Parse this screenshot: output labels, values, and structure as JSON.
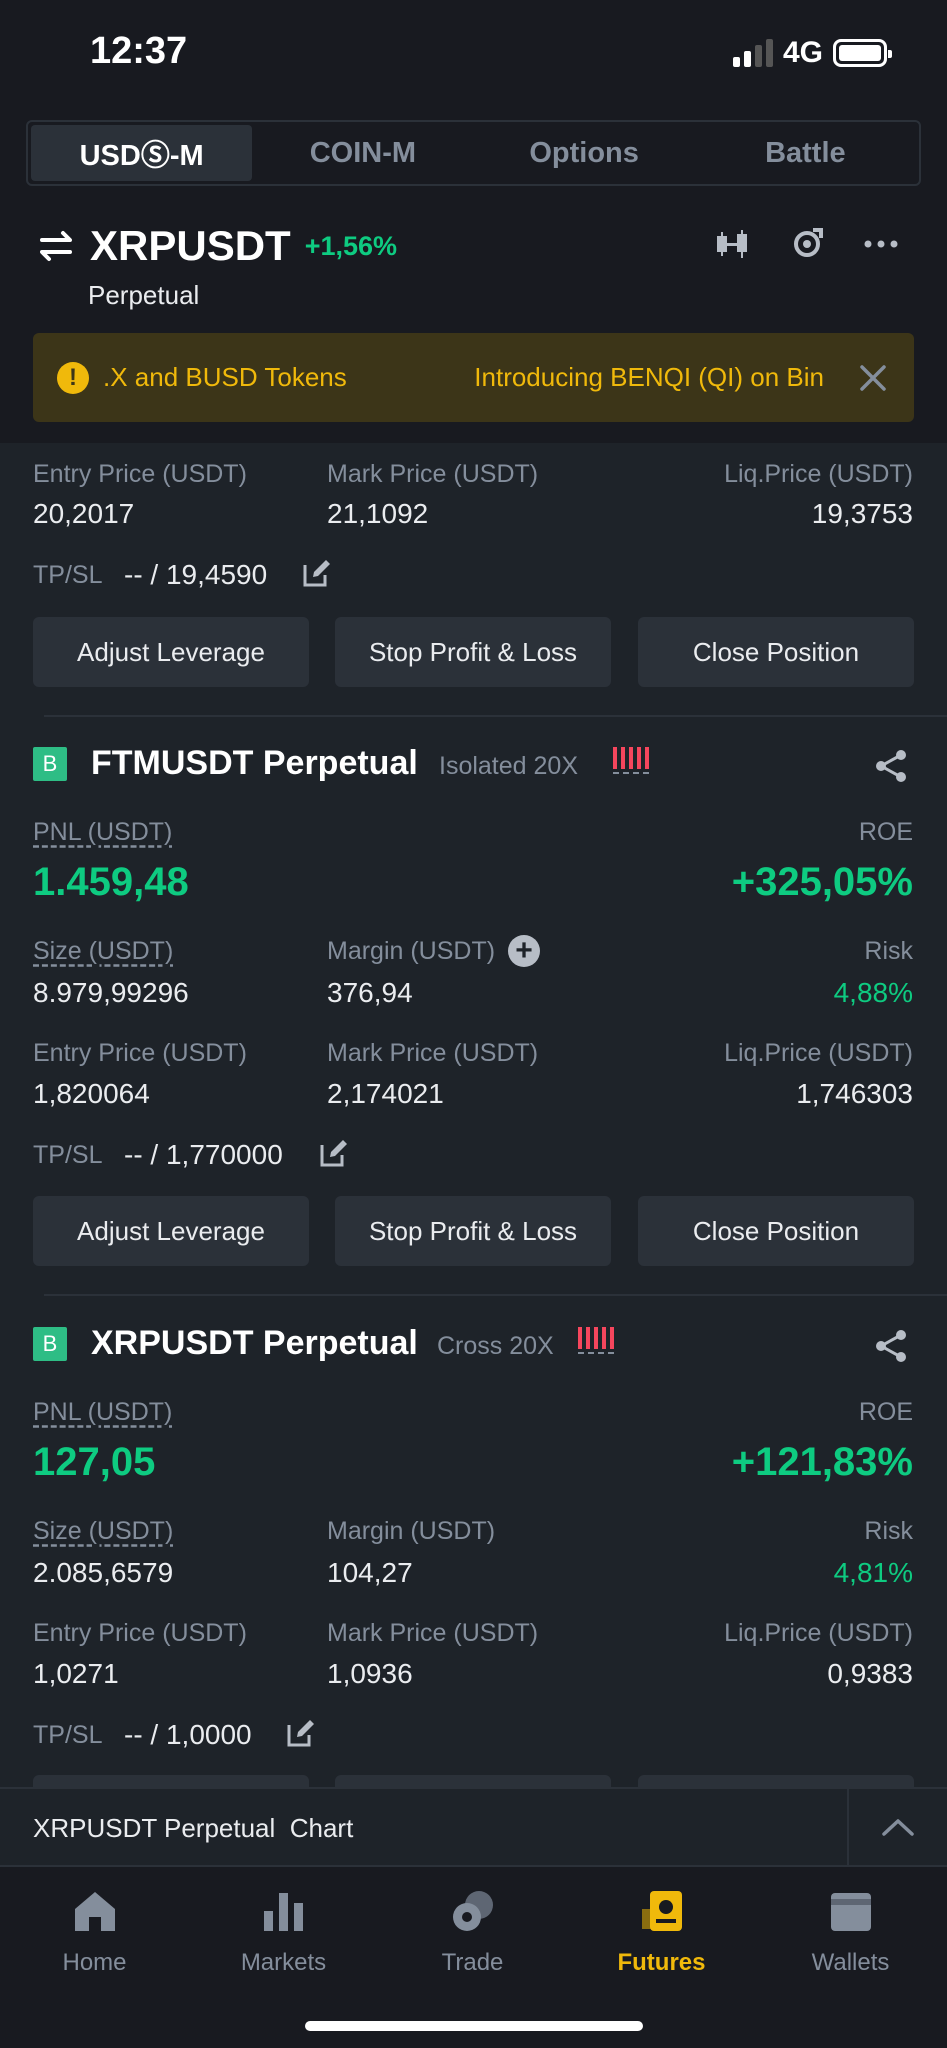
{
  "status": {
    "time": "12:37",
    "network": "4G"
  },
  "tabs": [
    {
      "label": "USDⓈ-M",
      "active": true
    },
    {
      "label": "COIN-M",
      "active": false
    },
    {
      "label": "Options",
      "active": false
    },
    {
      "label": "Battle",
      "active": false
    }
  ],
  "header": {
    "symbol": "XRPUSDT",
    "change": "+1,56%",
    "subtitle": "Perpetual"
  },
  "banner": {
    "text1": ".X and BUSD Tokens",
    "text2": "Introducing BENQI (QI) on Bin"
  },
  "positions": [
    {
      "entry_label": "Entry Price (USDT)",
      "entry": "20,2017",
      "mark_label": "Mark Price (USDT)",
      "mark": "21,1092",
      "liq_label": "Liq.Price (USDT)",
      "liq": "19,3753",
      "tpsl_label": "TP/SL",
      "tpsl": "-- / 19,4590"
    },
    {
      "badge": "B",
      "title": "FTMUSDT Perpetual",
      "mode": "Isolated 20X",
      "pnl_label": "PNL (USDT)",
      "pnl": "1.459,48",
      "roe_label": "ROE",
      "roe": "+325,05%",
      "size_label": "Size (USDT)",
      "size": "8.979,99296",
      "margin_label": "Margin (USDT)",
      "margin": "376,94",
      "risk_label": "Risk",
      "risk": "4,88%",
      "entry_label": "Entry Price (USDT)",
      "entry": "1,820064",
      "mark_label": "Mark Price (USDT)",
      "mark": "2,174021",
      "liq_label": "Liq.Price (USDT)",
      "liq": "1,746303",
      "tpsl_label": "TP/SL",
      "tpsl": "-- / 1,770000"
    },
    {
      "badge": "B",
      "title": "XRPUSDT Perpetual",
      "mode": "Cross 20X",
      "pnl_label": "PNL (USDT)",
      "pnl": "127,05",
      "roe_label": "ROE",
      "roe": "+121,83%",
      "size_label": "Size (USDT)",
      "size": "2.085,6579",
      "margin_label": "Margin (USDT)",
      "margin": "104,27",
      "risk_label": "Risk",
      "risk": "4,81%",
      "entry_label": "Entry Price (USDT)",
      "entry": "1,0271",
      "mark_label": "Mark Price (USDT)",
      "mark": "1,0936",
      "liq_label": "Liq.Price (USDT)",
      "liq": "0,9383",
      "tpsl_label": "TP/SL",
      "tpsl": "-- / 1,0000"
    }
  ],
  "buttons": {
    "adjust": "Adjust Leverage",
    "stop": "Stop Profit & Loss",
    "close": "Close Position"
  },
  "chart_bar": {
    "label": "XRPUSDT Perpetual  Chart"
  },
  "nav": [
    {
      "label": "Home",
      "icon": "home-icon"
    },
    {
      "label": "Markets",
      "icon": "markets-icon"
    },
    {
      "label": "Trade",
      "icon": "trade-icon"
    },
    {
      "label": "Futures",
      "icon": "futures-icon",
      "active": true
    },
    {
      "label": "Wallets",
      "icon": "wallet-icon"
    }
  ],
  "colors": {
    "positive": "#0ecb81",
    "accent": "#f0b90b",
    "danger": "#f6465d",
    "background": "#1e2329"
  }
}
